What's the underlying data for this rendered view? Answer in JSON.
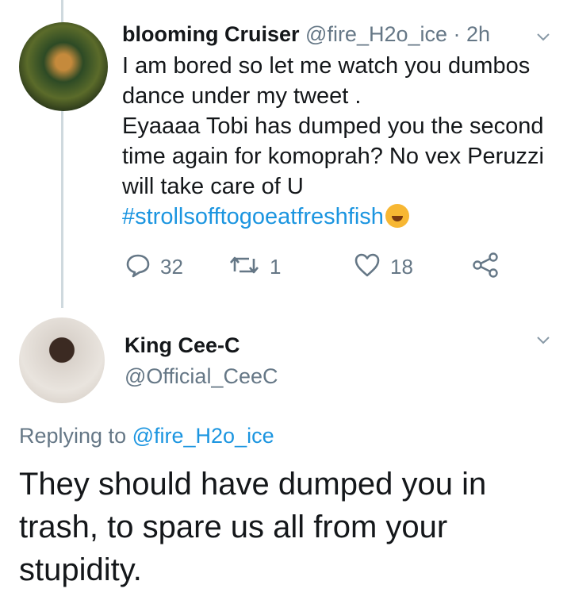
{
  "tweet1": {
    "author_name": "blooming Cruiser",
    "author_handle": "@fire_H2o_ice",
    "time": "· 2h",
    "line1": "I am bored so let me watch you dumbos dance under my tweet .",
    "line2": "Eyaaaa Tobi has dumped you the second time again for komoprah? No vex Peruzzi will take care of U",
    "hashtag": "#strollsofftogoeatfreshfish",
    "emoji": "rolling-on-floor-laughing-emoji",
    "actions": {
      "replies": "32",
      "retweets": "1",
      "likes": "18"
    },
    "icons": [
      "chevron-down-icon",
      "reply-icon",
      "retweet-icon",
      "like-icon",
      "share-icon"
    ]
  },
  "tweet2": {
    "author_name": "King Cee-C",
    "author_handle": "@Official_CeeC",
    "replying_prefix": "Replying to",
    "replying_to": "@fire_H2o_ice",
    "text": "They should have dumped you in trash, to spare us all from your stupidity."
  },
  "colors": {
    "link": "#1b95e0",
    "secondary_text": "#657786",
    "thread_line": "#cfd9de"
  }
}
